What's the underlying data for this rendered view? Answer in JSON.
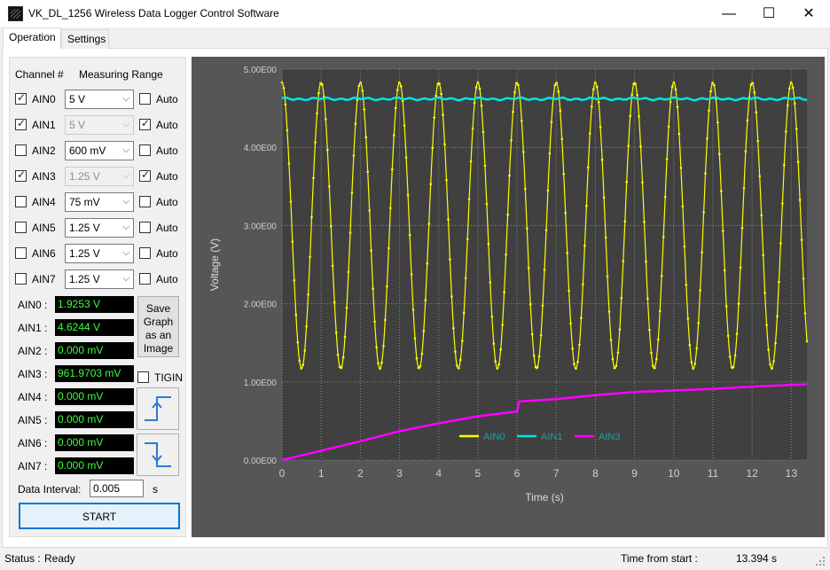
{
  "window": {
    "title": "VK_DL_1256 Wireless Data Logger Control Software",
    "minimize_glyph": "—",
    "maximize_glyph": "☐",
    "close_glyph": "✕"
  },
  "tabs": [
    {
      "label": "Operation",
      "active": true
    },
    {
      "label": "Settings",
      "active": false
    }
  ],
  "channels_header": {
    "channel": "Channel #",
    "range": "Measuring Range"
  },
  "channels": [
    {
      "name": "AIN0",
      "checked": true,
      "range": "5 V",
      "range_enabled": true,
      "auto_label": "Auto",
      "auto": false
    },
    {
      "name": "AIN1",
      "checked": true,
      "range": "5 V",
      "range_enabled": false,
      "auto_label": "Auto",
      "auto": true
    },
    {
      "name": "AIN2",
      "checked": false,
      "range": "600 mV",
      "range_enabled": true,
      "auto_label": "Auto",
      "auto": false
    },
    {
      "name": "AIN3",
      "checked": true,
      "range": "1.25 V",
      "range_enabled": false,
      "auto_label": "Auto",
      "auto": true
    },
    {
      "name": "AIN4",
      "checked": false,
      "range": "75 mV",
      "range_enabled": true,
      "auto_label": "Auto",
      "auto": false
    },
    {
      "name": "AIN5",
      "checked": false,
      "range": "1.25 V",
      "range_enabled": true,
      "auto_label": "Auto",
      "auto": false
    },
    {
      "name": "AIN6",
      "checked": false,
      "range": "1.25 V",
      "range_enabled": true,
      "auto_label": "Auto",
      "auto": false
    },
    {
      "name": "AIN7",
      "checked": false,
      "range": "1.25 V",
      "range_enabled": true,
      "auto_label": "Auto",
      "auto": false
    }
  ],
  "readouts": [
    {
      "label": "AIN0 :",
      "value": "1.9253 V"
    },
    {
      "label": "AIN1 :",
      "value": "4.6244 V"
    },
    {
      "label": "AIN2 :",
      "value": "0.000 mV"
    },
    {
      "label": "AIN3 :",
      "value": "961.9703 mV"
    },
    {
      "label": "AIN4 :",
      "value": "0.000 mV"
    },
    {
      "label": "AIN5 :",
      "value": "0.000 mV"
    },
    {
      "label": "AIN6 :",
      "value": "0.000 mV"
    },
    {
      "label": "AIN7 :",
      "value": "0.000 mV"
    }
  ],
  "save_button": {
    "lines": [
      "Save",
      "Graph",
      "as an",
      "Image"
    ]
  },
  "tigin": {
    "label": "TIGIN",
    "checked": false
  },
  "rising_edge_icon": "rising-edge-icon",
  "falling_edge_icon": "falling-edge-icon",
  "data_interval": {
    "label": "Data Interval:",
    "value": "0.005",
    "unit": "s"
  },
  "start_button": {
    "label": "START"
  },
  "status": {
    "label": "Status :",
    "value": "Ready",
    "time_label": "Time from start :",
    "time_value": "13.394 s"
  },
  "colors": {
    "accent": "#0078d7",
    "readout_text": "#3cff3c",
    "plot_bg": "#404040",
    "panel_bg": "#565656"
  },
  "chart_data": {
    "type": "line",
    "xlabel": "Time (s)",
    "ylabel": "Voltage (V)",
    "xlim": [
      0,
      13.4
    ],
    "ylim": [
      0,
      5
    ],
    "x_ticks": [
      "0",
      "1",
      "2",
      "3",
      "4",
      "5",
      "6",
      "7",
      "8",
      "9",
      "10",
      "11",
      "12",
      "13"
    ],
    "y_ticks": [
      "0.00E00",
      "1.00E00",
      "2.00E00",
      "3.00E00",
      "4.00E00",
      "5.00E00"
    ],
    "grid": true,
    "legend_position": "bottom-center",
    "series": [
      {
        "name": "AIN0",
        "color": "#ffff00",
        "shape": "sine",
        "offset": 3.0,
        "amplitude": 1.83,
        "period_s": 1.0,
        "phase_s": 0.0,
        "markers": true
      },
      {
        "name": "AIN1",
        "color": "#00e5e5",
        "shape": "flat",
        "level": 4.62,
        "markers": false
      },
      {
        "name": "AIN3",
        "color": "#ff00ff",
        "shape": "charging",
        "points": [
          [
            0,
            0
          ],
          [
            1,
            0.12
          ],
          [
            2,
            0.24
          ],
          [
            3,
            0.37
          ],
          [
            4,
            0.47
          ],
          [
            5,
            0.56
          ],
          [
            6.0,
            0.62
          ],
          [
            6.05,
            0.75
          ],
          [
            7,
            0.78
          ],
          [
            8,
            0.83
          ],
          [
            9,
            0.87
          ],
          [
            10,
            0.89
          ],
          [
            11,
            0.91
          ],
          [
            12,
            0.94
          ],
          [
            13,
            0.96
          ],
          [
            13.4,
            0.97
          ]
        ],
        "markers": false
      }
    ]
  }
}
